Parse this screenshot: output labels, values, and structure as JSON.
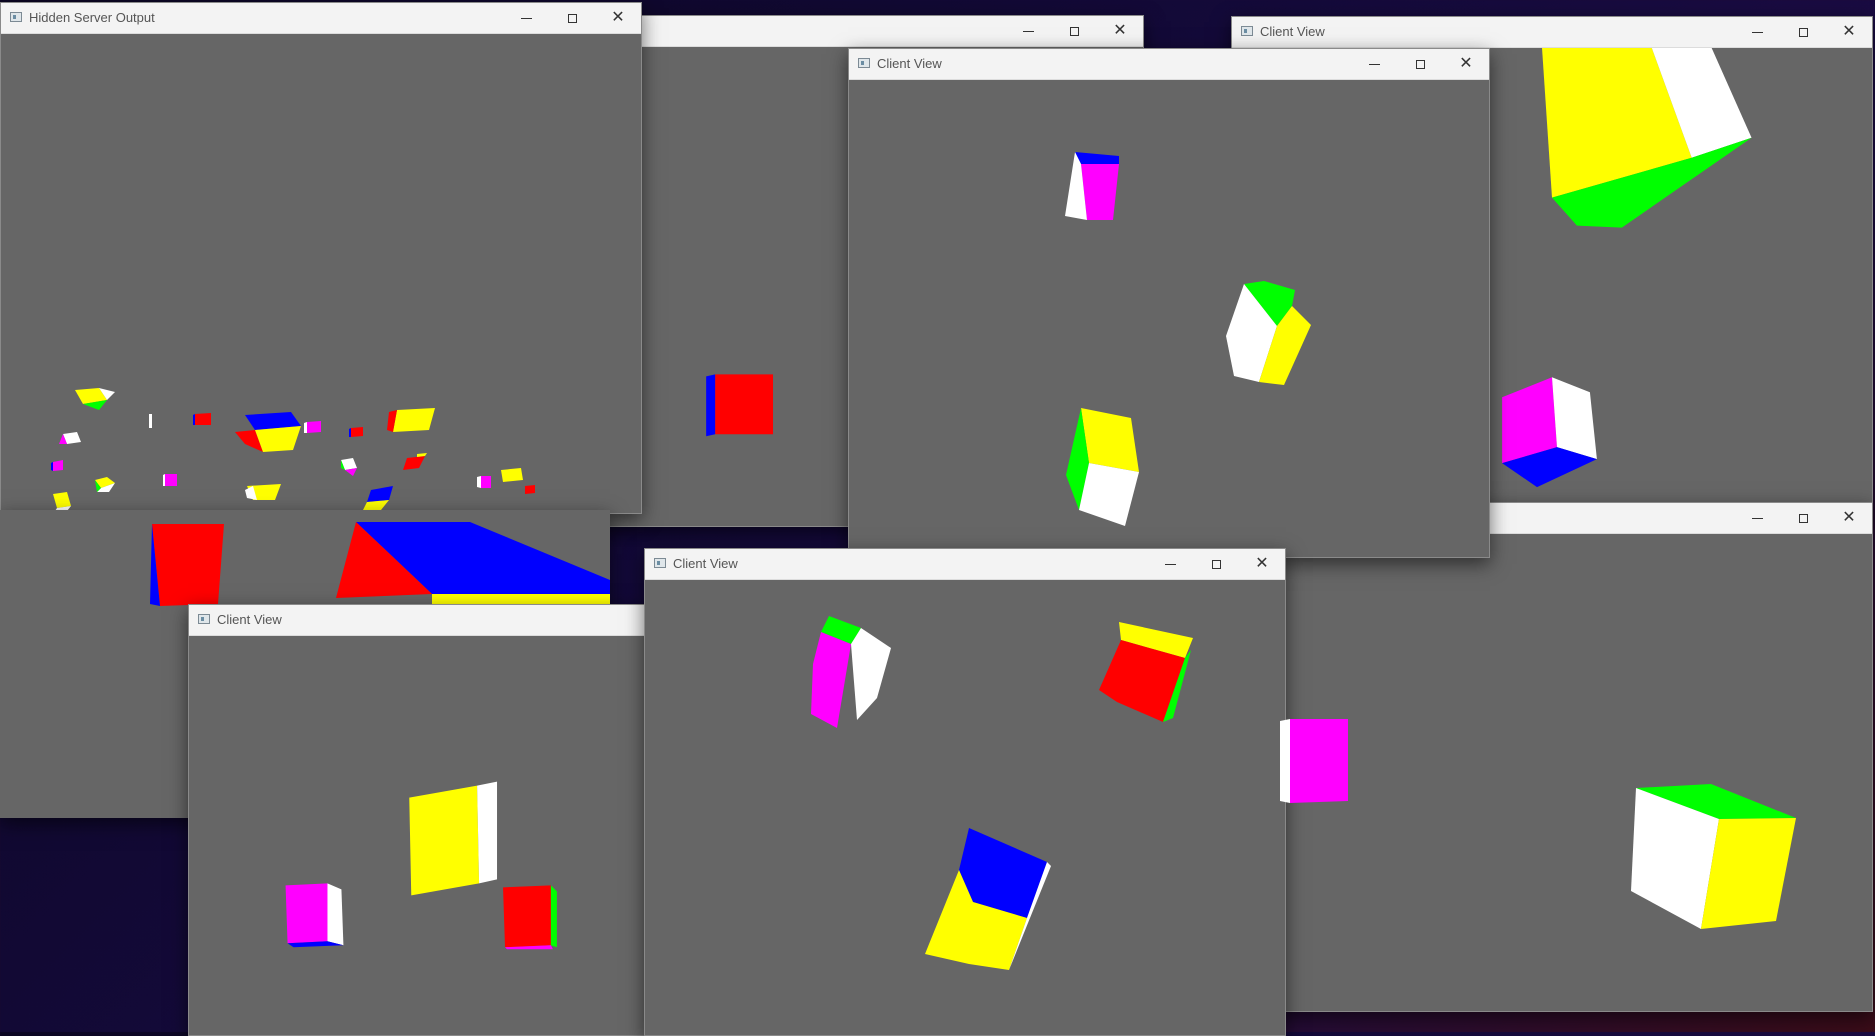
{
  "desktop": {
    "accent_colors": {
      "viewport_bg": "#666666",
      "cube_red": "#ff0000",
      "cube_blue": "#0000ff",
      "cube_yellow": "#ffff00",
      "cube_green": "#00ff00",
      "cube_magenta": "#ff00ff",
      "cube_white": "#ffffff"
    }
  },
  "windows": {
    "server": {
      "title": "Hidden Server Output"
    },
    "back_top": {
      "title": ""
    },
    "top_right": {
      "title": "Client View"
    },
    "center_top": {
      "title": "Client View"
    },
    "right_bottom": {
      "title": ""
    },
    "bottom_left": {
      "title": "Client View"
    },
    "bottom_center": {
      "title": "Client View"
    }
  },
  "controls": {
    "minimize_icon": "minimize-icon",
    "maximize_icon": "maximize-icon",
    "close_icon": "close-icon",
    "close_glyph": "✕"
  }
}
